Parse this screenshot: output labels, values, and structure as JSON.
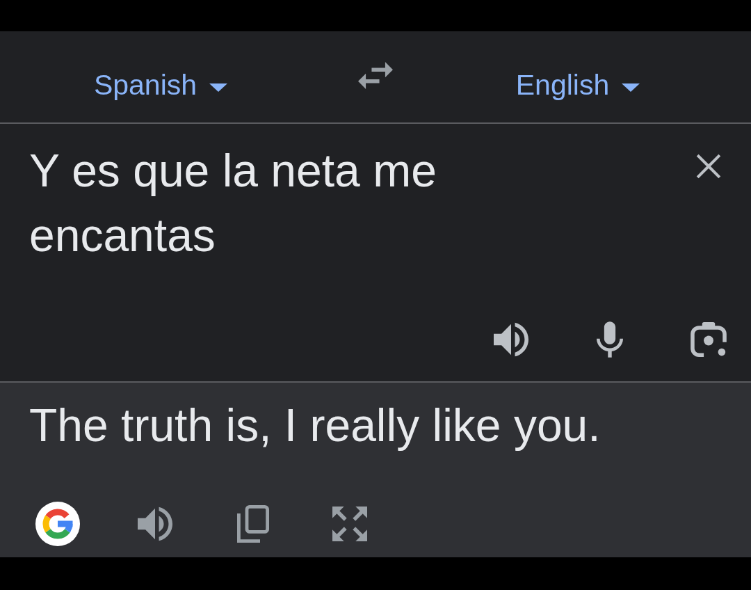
{
  "languages": {
    "source": {
      "label": "Spanish"
    },
    "target": {
      "label": "English"
    }
  },
  "input": {
    "value": "Y es que la neta me encantas"
  },
  "output": {
    "text": "The truth is, I really like you."
  }
}
